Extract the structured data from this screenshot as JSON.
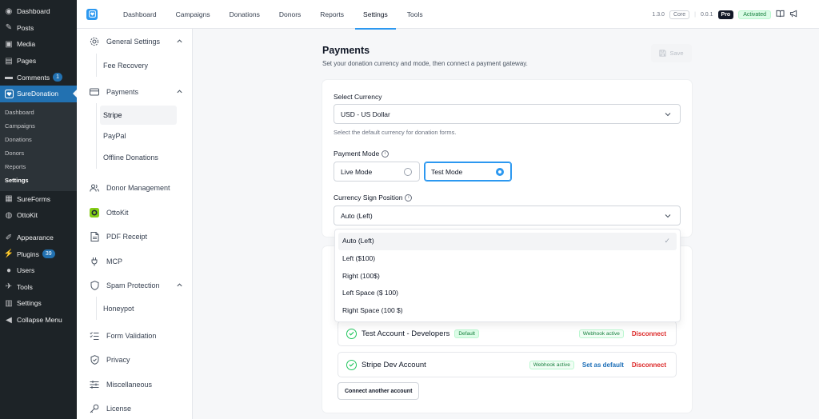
{
  "wp_menu": {
    "items_top": [
      {
        "label": "Dashboard",
        "icon": "dashboard-icon",
        "glyph": "◉"
      },
      {
        "label": "Posts",
        "icon": "pin-icon",
        "glyph": "✎"
      },
      {
        "label": "Media",
        "icon": "media-icon",
        "glyph": "▣"
      },
      {
        "label": "Pages",
        "icon": "pages-icon",
        "glyph": "▤"
      },
      {
        "label": "Comments",
        "icon": "comment-icon",
        "glyph": "▬",
        "badge": "1"
      }
    ],
    "active": {
      "label": "SureDonation",
      "icon": "suredonation-icon"
    },
    "submenu": [
      "Dashboard",
      "Campaigns",
      "Donations",
      "Donors",
      "Reports",
      "Settings"
    ],
    "submenu_current": "Settings",
    "items_mid": [
      {
        "label": "SureForms",
        "icon": "sureforms-icon",
        "glyph": "▦"
      },
      {
        "label": "OttoKit",
        "icon": "ottokit-icon",
        "glyph": "◍"
      }
    ],
    "items_bottom": [
      {
        "label": "Appearance",
        "icon": "brush-icon",
        "glyph": "✐"
      },
      {
        "label": "Plugins",
        "icon": "plug-icon",
        "glyph": "⚡",
        "badge": "39"
      },
      {
        "label": "Users",
        "icon": "user-icon",
        "glyph": "●"
      },
      {
        "label": "Tools",
        "icon": "wrench-icon",
        "glyph": "✈"
      },
      {
        "label": "Settings",
        "icon": "sliders-icon",
        "glyph": "▥"
      },
      {
        "label": "Collapse Menu",
        "icon": "collapse-icon",
        "glyph": "◀"
      }
    ]
  },
  "topnav": {
    "tabs": [
      "Dashboard",
      "Campaigns",
      "Donations",
      "Donors",
      "Reports",
      "Settings",
      "Tools"
    ],
    "active_tab": "Settings",
    "version": "1.3.0",
    "core_label": "Core",
    "pro_version": "0.0.1",
    "pro_label": "Pro",
    "status": "Activated"
  },
  "settings_nav": {
    "general": "General Settings",
    "fee_recovery": "Fee Recovery",
    "payments": "Payments",
    "payments_sub": [
      "Stripe",
      "PayPal",
      "Offline Donations"
    ],
    "payments_current": "Stripe",
    "donor_management": "Donor Management",
    "ottokit": "OttoKit",
    "pdf_receipt": "PDF Receipt",
    "mcp": "MCP",
    "spam_protection": "Spam Protection",
    "honeypot": "Honeypot",
    "form_validation": "Form Validation",
    "privacy": "Privacy",
    "miscellaneous": "Miscellaneous",
    "license": "License"
  },
  "page": {
    "title": "Payments",
    "subtitle": "Set your donation currency and mode, then connect a payment gateway.",
    "save_label": "Save"
  },
  "form": {
    "currency_label": "Select Currency",
    "currency_value": "USD - US Dollar",
    "currency_help": "Select the default currency for donation forms.",
    "mode_label": "Payment Mode",
    "mode_options": [
      "Live Mode",
      "Test Mode"
    ],
    "mode_selected": "Test Mode",
    "sign_label": "Currency Sign Position",
    "sign_value": "Auto (Left)"
  },
  "dropdown": {
    "options": [
      "Auto (Left)",
      "Left ($100)",
      "Right (100$)",
      "Left Space ($ 100)",
      "Right Space (100 $)"
    ],
    "selected": "Auto (Left)"
  },
  "accounts": {
    "list": [
      {
        "name": "Test Account - Developers",
        "badge": "Default",
        "webhook": "Webhook active",
        "action": "Disconnect"
      },
      {
        "name": "Stripe Dev Account",
        "webhook": "Webhook active",
        "set_default": "Set as default",
        "action": "Disconnect"
      }
    ],
    "connect_label": "Connect another account"
  },
  "colors": {
    "accent": "#2c98f0",
    "wp_sidebar": "#1d2327",
    "wp_active": "#2271b1",
    "danger": "#dc2626",
    "success": "#15803d"
  }
}
